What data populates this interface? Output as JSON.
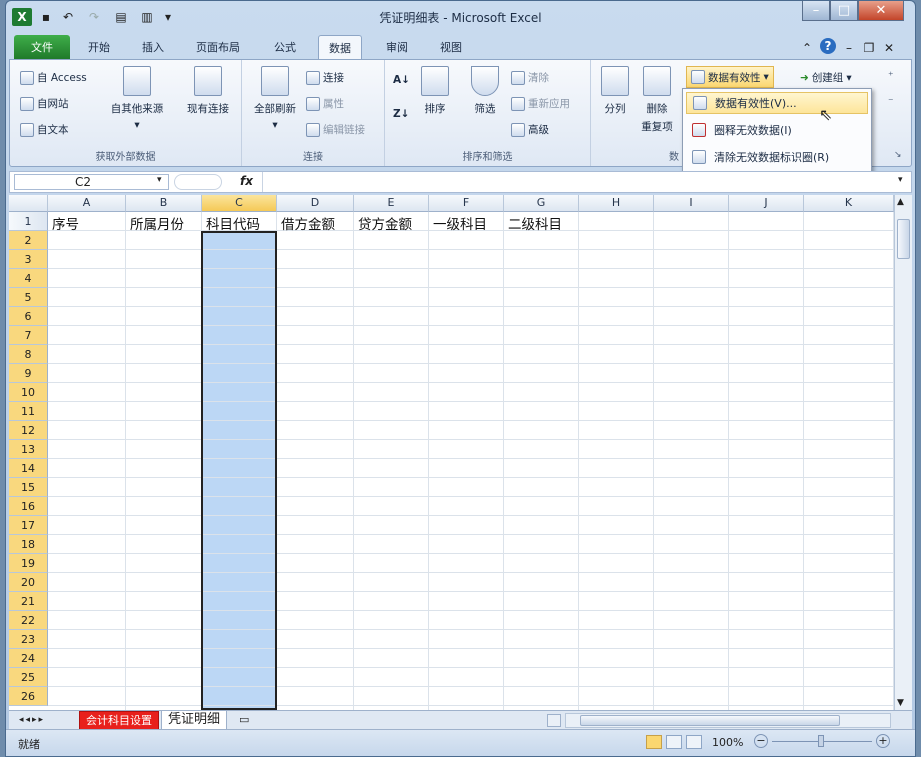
{
  "window": {
    "title": "凭证明细表 - Microsoft Excel",
    "minimize": "–",
    "maximize": "□",
    "close": "✕"
  },
  "quick_access": [
    "save-icon",
    "undo-icon",
    "redo-icon",
    "print-icon",
    "customize-icon"
  ],
  "ribbon_tabs": [
    "文件",
    "开始",
    "插入",
    "页面布局",
    "公式",
    "数据",
    "审阅",
    "视图"
  ],
  "active_tab": "数据",
  "ribbon_right_icons": [
    "minimize-ribbon-icon",
    "help-icon",
    "window-min-icon",
    "window-restore-icon",
    "window-close-icon"
  ],
  "groups": {
    "external": {
      "label": "获取外部数据",
      "access": "自 Access",
      "web": "自网站",
      "text": "自文本",
      "other": "自其他来源",
      "existing": "现有连接"
    },
    "connections": {
      "label": "连接",
      "refresh_all": "全部刷新",
      "connect": "连接",
      "properties": "属性",
      "edit_links": "编辑链接"
    },
    "sort": {
      "label": "排序和筛选",
      "sort": "排序",
      "filter": "筛选",
      "clear": "清除",
      "reapply": "重新应用",
      "advanced": "高级"
    },
    "tools": {
      "label": "数据",
      "split": "分列",
      "remove_dup": "删除",
      "remove_dup2": "重复项",
      "validation": "数据有效性"
    },
    "outline": {
      "create_group": "创建组"
    }
  },
  "dropdown": [
    "数据有效性(V)...",
    "圈释无效数据(I)",
    "清除无效数据标识圈(R)"
  ],
  "namebox": "C2",
  "formula_symbol": "fx",
  "columns": [
    "A",
    "B",
    "C",
    "D",
    "E",
    "F",
    "G",
    "H",
    "I",
    "J",
    "K"
  ],
  "rows": [
    "1",
    "2",
    "3",
    "4",
    "5",
    "6",
    "7",
    "8",
    "9",
    "10",
    "11",
    "12",
    "13",
    "14",
    "15",
    "16",
    "17",
    "18",
    "19",
    "20",
    "21",
    "22",
    "23",
    "24",
    "25",
    "26"
  ],
  "headers_row": [
    "序号",
    "所属月份",
    "科目代码",
    "借方金额",
    "贷方金额",
    "一级科目",
    "二级科目"
  ],
  "sheet_tabs": [
    "会计科目设置",
    "凭证明细"
  ],
  "status": {
    "ready": "就绪",
    "zoom": "100%"
  }
}
